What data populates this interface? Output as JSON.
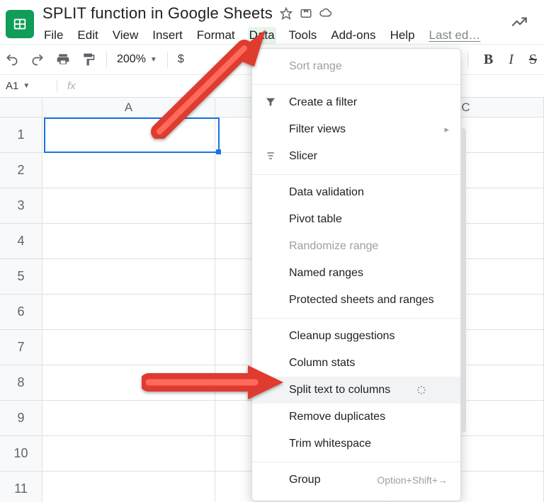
{
  "doc": {
    "title": "SPLIT function in Google Sheets"
  },
  "menu": {
    "file": "File",
    "edit": "Edit",
    "view": "View",
    "insert": "Insert",
    "format": "Format",
    "data": "Data",
    "tools": "Tools",
    "addons": "Add-ons",
    "help": "Help",
    "lastedit": "Last ed…"
  },
  "toolbar": {
    "zoom": "200%",
    "currency": "$"
  },
  "fx": {
    "namebox": "A1",
    "fx_label": "fx"
  },
  "columns": {
    "a": "A",
    "c": "C"
  },
  "rows": [
    "1",
    "2",
    "3",
    "4",
    "5",
    "6",
    "7",
    "8",
    "9",
    "10",
    "11"
  ],
  "data_menu": {
    "sort_range": "Sort range",
    "create_filter": "Create a filter",
    "filter_views": "Filter views",
    "slicer": "Slicer",
    "data_validation": "Data validation",
    "pivot_table": "Pivot table",
    "randomize": "Randomize range",
    "named_ranges": "Named ranges",
    "protected": "Protected sheets and ranges",
    "cleanup": "Cleanup suggestions",
    "column_stats": "Column stats",
    "split_text": "Split text to columns",
    "remove_dup": "Remove duplicates",
    "trim_ws": "Trim whitespace",
    "group": "Group",
    "group_shortcut": "Option+Shift+→"
  }
}
